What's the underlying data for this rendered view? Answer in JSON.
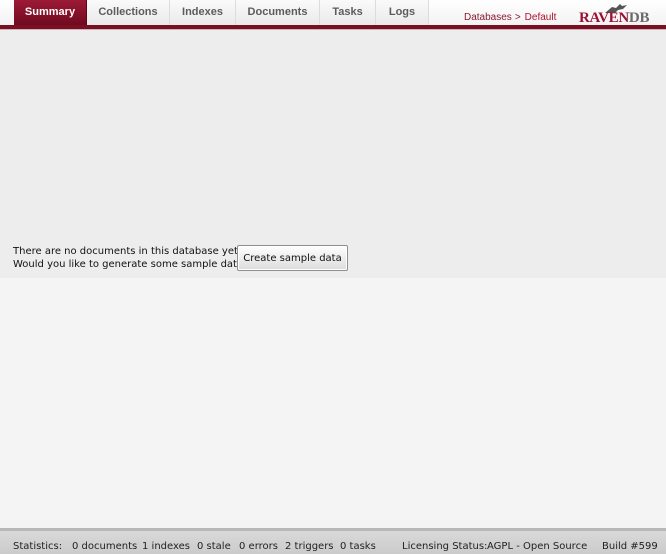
{
  "nav": {
    "tabs": [
      {
        "label": "Summary",
        "active": true
      },
      {
        "label": "Collections"
      },
      {
        "label": "Indexes"
      },
      {
        "label": "Documents"
      },
      {
        "label": "Tasks"
      },
      {
        "label": "Logs"
      }
    ],
    "breadcrumb": {
      "root": "Databases",
      "separator": ">",
      "current": "Default"
    },
    "logo": {
      "text_main": "RAVEN",
      "text_suffix": "DB",
      "icon": "raven-logo-icon"
    }
  },
  "main": {
    "notice_line1": "There are no documents in this database yet.",
    "notice_line2": "Would you like to generate some sample data?",
    "sample_button_label": "Create sample data"
  },
  "status": {
    "label": "Statistics:",
    "documents": "0 documents",
    "indexes": "1 indexes",
    "stale": "0 stale",
    "errors": "0 errors",
    "triggers": "2 triggers",
    "tasks": "0 tasks",
    "licensing_label": "Licensing Status:",
    "licensing_value": "AGPL - Open Source",
    "build": "Build #599"
  },
  "colors": {
    "accent": "#7a0f24",
    "tab_active": "#8b1530",
    "link": "#8b1a33"
  }
}
